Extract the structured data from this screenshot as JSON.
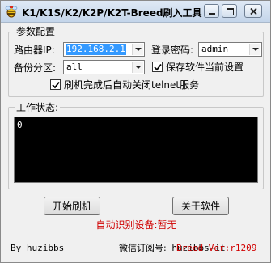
{
  "window": {
    "title": "K1/K1S/K2/K2P/K2T-Breed刷入工具"
  },
  "params": {
    "group_title": "参数配置",
    "router_ip_label": "路由器IP:",
    "router_ip_value": "192.168.2.1",
    "password_label": "登录密码:",
    "password_value": "admin",
    "backup_label": "备份分区:",
    "backup_value": "all",
    "save_settings_label": "保存软件当前设置",
    "save_settings_checked": true,
    "auto_close_telnet_label": "刷机完成后自动关闭telnet服务",
    "auto_close_telnet_checked": true
  },
  "work_status": {
    "group_title": "工作状态:",
    "log_text": "0"
  },
  "buttons": {
    "start_flash": "开始刷机",
    "about": "关于软件"
  },
  "status_text": "自动识别设备:暂无",
  "footer": {
    "by": "By huzibbs",
    "wechat_label": "微信订阅号:",
    "wechat_id": "huzibbs-it",
    "version": "Breed Ver:r1209"
  },
  "colors": {
    "status_red": "#d00000",
    "selection_blue": "#3399ff",
    "console_bg": "#000000"
  },
  "icons": {
    "app": "bee-icon",
    "minimize": "minimize-icon",
    "maximize": "maximize-icon",
    "close": "close-icon"
  }
}
